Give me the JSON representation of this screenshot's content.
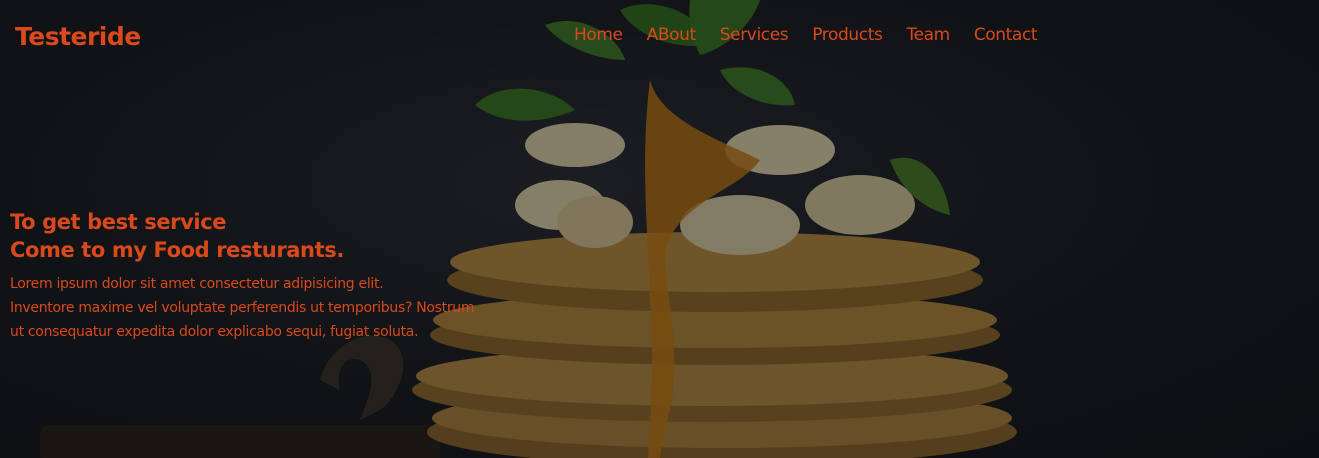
{
  "brand": {
    "name": "Testeride"
  },
  "nav": {
    "items": [
      {
        "label": "Home"
      },
      {
        "label": "ABout"
      },
      {
        "label": "Services"
      },
      {
        "label": "Products"
      },
      {
        "label": "Team"
      },
      {
        "label": "Contact"
      }
    ]
  },
  "hero": {
    "heading_line1": "To get best service",
    "heading_line2": "Come to my Food resturants.",
    "desc_line1": "Lorem ipsum dolor sit amet consectetur adipisicing elit.",
    "desc_line2": "Inventore maxime vel voluptate perferendis ut temporibus? Nostrum",
    "desc_line3": "ut consequatur expedita dolor explicabo sequi, fugiat soluta."
  },
  "colors": {
    "accent": "#d9491c",
    "background": "#1b1f24",
    "pancake": "#a8803f",
    "syrup": "#c07a1a",
    "banana": "#d9cfa9",
    "mint": "#3f7a2a"
  },
  "icons": {
    "hero_image": "pancake-stack-image"
  }
}
